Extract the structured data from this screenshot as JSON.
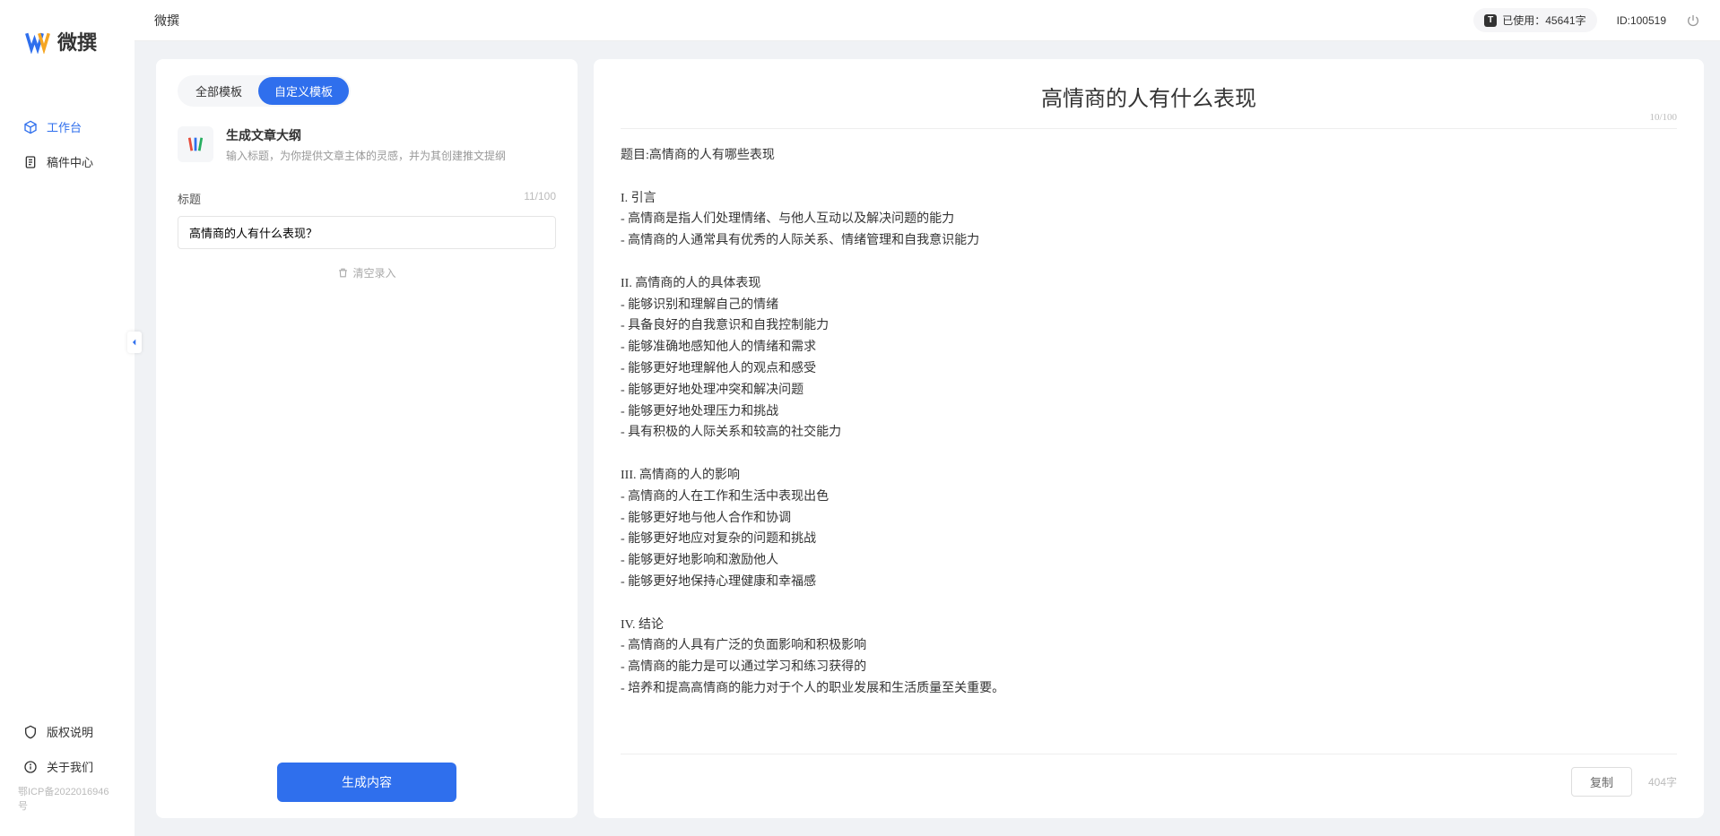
{
  "app_name": "微撰",
  "header": {
    "title": "微撰",
    "usage_label": "已使用：45641字",
    "user_id": "ID:100519"
  },
  "sidebar": {
    "items": [
      {
        "label": "工作台",
        "active": true
      },
      {
        "label": "稿件中心",
        "active": false
      }
    ],
    "bottom": [
      {
        "label": "版权说明"
      },
      {
        "label": "关于我们"
      }
    ],
    "icp": "鄂ICP备2022016946号"
  },
  "left_panel": {
    "tabs": [
      {
        "label": "全部模板",
        "active": false
      },
      {
        "label": "自定义模板",
        "active": true
      }
    ],
    "template": {
      "title": "生成文章大纲",
      "desc": "输入标题，为你提供文章主体的灵感，并为其创建推文提纲"
    },
    "field_label": "标题",
    "field_count": "11/100",
    "input_value": "高情商的人有什么表现？",
    "clear_label": "清空录入",
    "generate_label": "生成内容"
  },
  "right_panel": {
    "title": "高情商的人有什么表现",
    "top_count": "10/100",
    "body": "题目:高情商的人有哪些表现\n\nI. 引言\n- 高情商是指人们处理情绪、与他人互动以及解决问题的能力\n- 高情商的人通常具有优秀的人际关系、情绪管理和自我意识能力\n\nII. 高情商的人的具体表现\n- 能够识别和理解自己的情绪\n- 具备良好的自我意识和自我控制能力\n- 能够准确地感知他人的情绪和需求\n- 能够更好地理解他人的观点和感受\n- 能够更好地处理冲突和解决问题\n- 能够更好地处理压力和挑战\n- 具有积极的人际关系和较高的社交能力\n\nIII. 高情商的人的影响\n- 高情商的人在工作和生活中表现出色\n- 能够更好地与他人合作和协调\n- 能够更好地应对复杂的问题和挑战\n- 能够更好地影响和激励他人\n- 能够更好地保持心理健康和幸福感\n\nIV. 结论\n- 高情商的人具有广泛的负面影响和积极影响\n- 高情商的能力是可以通过学习和练习获得的\n- 培养和提高高情商的能力对于个人的职业发展和生活质量至关重要。",
    "copy_label": "复制",
    "word_count": "404字"
  }
}
